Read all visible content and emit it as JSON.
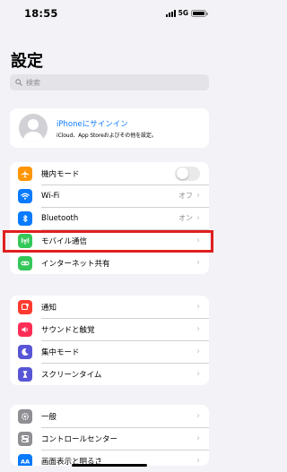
{
  "status_bar": {
    "time": "18:55",
    "network": "5G",
    "battery_level": 1.0
  },
  "title": "設定",
  "search": {
    "placeholder": "検索"
  },
  "profile": {
    "title": "iPhoneにサインイン",
    "subtitle": "iCloud、App Storeおよびその他を設定。"
  },
  "group1": [
    {
      "name": "airplane-mode",
      "label": "機内モード",
      "color": "#ff9500",
      "icon": "airplane-icon",
      "toggle": false
    },
    {
      "name": "wifi",
      "label": "Wi-Fi",
      "color": "#0a7aff",
      "icon": "wifi-icon",
      "value": "オフ"
    },
    {
      "name": "bluetooth",
      "label": "Bluetooth",
      "color": "#0a7aff",
      "icon": "bluetooth-icon",
      "value": "オン"
    },
    {
      "name": "cellular",
      "label": "モバイル通信",
      "color": "#34c759",
      "icon": "antenna-icon",
      "value": ""
    },
    {
      "name": "personal-hotspot",
      "label": "インターネット共有",
      "color": "#34c759",
      "icon": "link-icon",
      "value": ""
    }
  ],
  "group2": [
    {
      "name": "notifications",
      "label": "通知",
      "color": "#ff3b30",
      "icon": "bell-icon"
    },
    {
      "name": "sounds",
      "label": "サウンドと触覚",
      "color": "#ff2d55",
      "icon": "speaker-icon"
    },
    {
      "name": "focus",
      "label": "集中モード",
      "color": "#5856d6",
      "icon": "moon-icon"
    },
    {
      "name": "screen-time",
      "label": "スクリーンタイム",
      "color": "#5856d6",
      "icon": "hourglass-icon"
    }
  ],
  "group3": [
    {
      "name": "general",
      "label": "一般",
      "color": "#8e8e93",
      "icon": "gear-icon"
    },
    {
      "name": "control-center",
      "label": "コントロールセンター",
      "color": "#8e8e93",
      "icon": "switches-icon"
    },
    {
      "name": "display-brightness",
      "label": "画面表示と明るさ",
      "color": "#0a7aff",
      "icon": "sun-icon"
    }
  ]
}
